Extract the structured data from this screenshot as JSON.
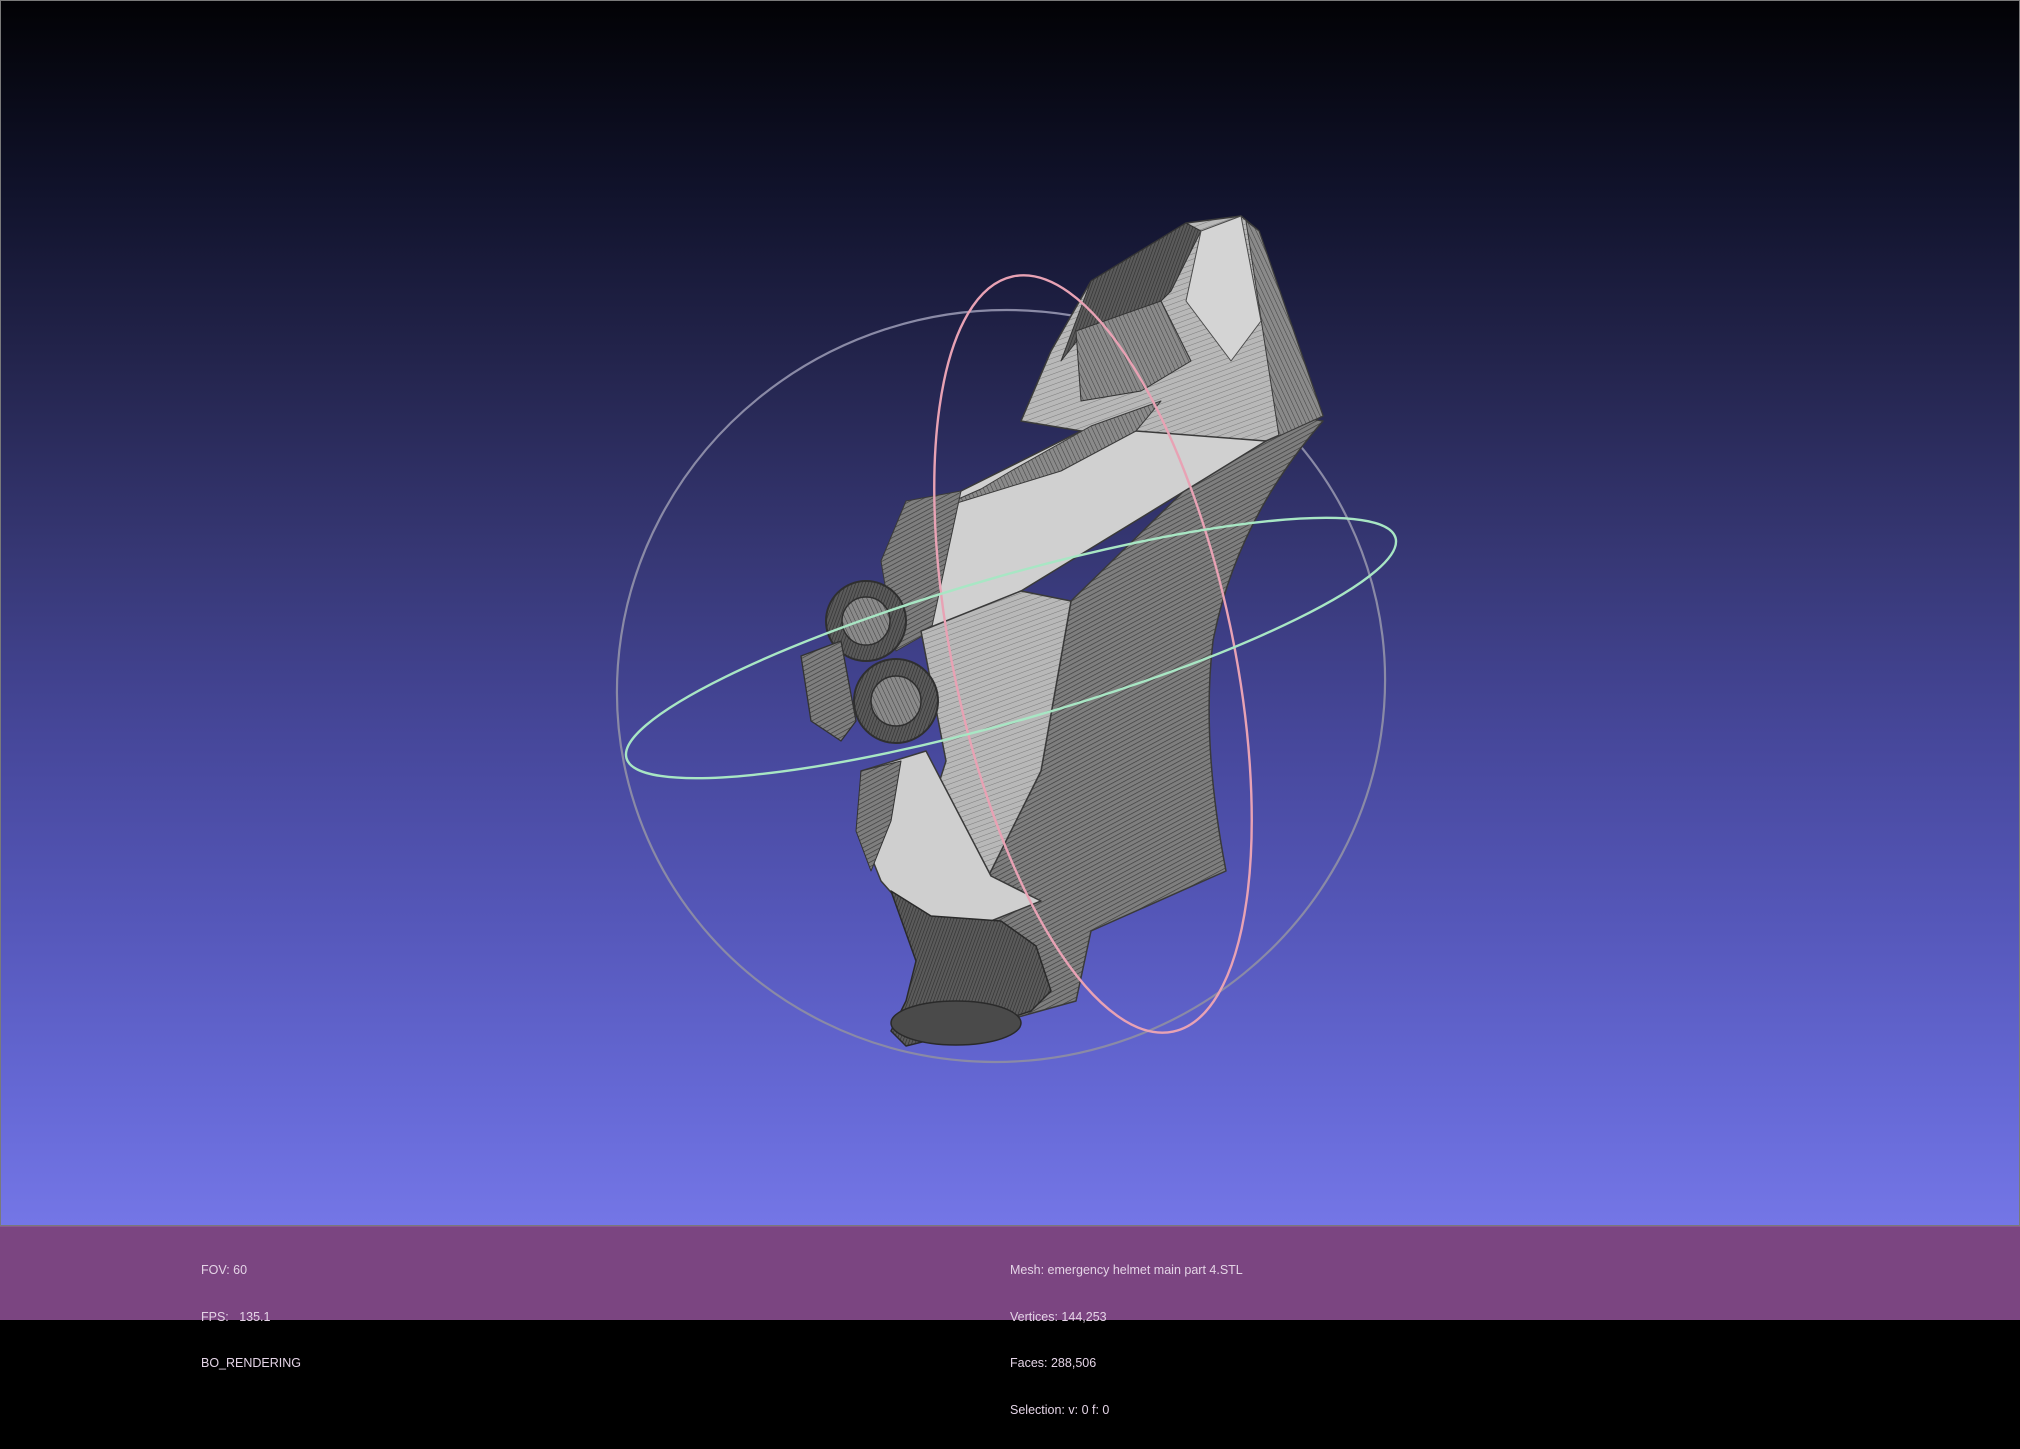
{
  "viewer": {
    "render_stats": {
      "fov": "FOV: 60",
      "fps": "FPS:   135.1",
      "render_mode": "BO_RENDERING"
    },
    "mesh_info": {
      "mesh": "Mesh: emergency helmet main part 4.STL",
      "vertices": "Vertices: 144,253",
      "faces": "Faces: 288,506",
      "selection": "Selection: v: 0 f: 0"
    }
  },
  "colors": {
    "background_top": "#020205",
    "background_bottom": "#7476e6",
    "info_bar": "#7b4581",
    "trackball_red": "#e8a2b4",
    "trackball_green": "#a8e6c4",
    "trackball_gray": "#8a8aa6",
    "mesh_light": "#d2d2d2",
    "mesh_mid": "#8c8c8c",
    "mesh_dark": "#4a4a4a"
  }
}
